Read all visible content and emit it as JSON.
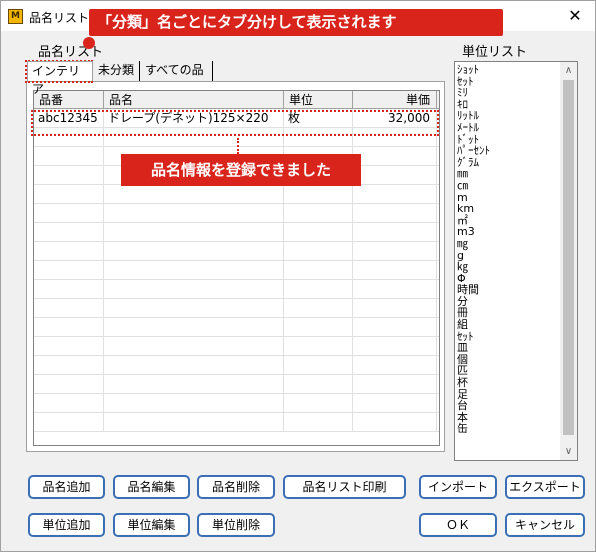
{
  "window": {
    "title": "品名リスト編集",
    "close_glyph": "✕"
  },
  "labels": {
    "hinmei_list": "品名リスト",
    "unit_list": "単位リスト"
  },
  "tabs": [
    {
      "label": "インテリア",
      "active": true
    },
    {
      "label": "未分類",
      "active": false
    },
    {
      "label": "すべての品",
      "active": false
    }
  ],
  "grid": {
    "columns": [
      "品番",
      "品名",
      "単位",
      "単価"
    ],
    "rows": [
      {
        "code": "abc12345",
        "name": "ドレープ(デネット)125×220",
        "unit": "枚",
        "price": "32,000"
      }
    ]
  },
  "units": [
    "ｼｮｯﾄ",
    "ｾｯﾄ",
    "ﾐﾘ",
    "ｷﾛ",
    "ﾘｯﾄﾙ",
    "ﾒｰﾄﾙ",
    "ﾄﾞｯﾄ",
    "ﾊﾟｰｾﾝﾄ",
    "ｸﾞﾗﾑ",
    "㎜",
    "㎝",
    "m",
    "km",
    "㎡",
    "m3",
    "㎎",
    "g",
    "㎏",
    "Φ",
    "時間",
    "分",
    "冊",
    "組",
    "ｾｯﾄ",
    "皿",
    "個",
    "匹",
    "杯",
    "足",
    "台",
    "本",
    "缶"
  ],
  "buttons": {
    "add_item": "品名追加",
    "edit_item": "品名編集",
    "delete_item": "品名削除",
    "print_list": "品名リスト印刷",
    "import": "インポート",
    "export": "エクスポート",
    "add_unit": "単位追加",
    "edit_unit": "単位編集",
    "delete_unit": "単位削除",
    "ok": "ＯＫ",
    "cancel": "キャンセル"
  },
  "annotations": {
    "tabs_note": "「分類」名ごとにタブ分けして表示されます",
    "registered_note": "品名情報を登録できました"
  },
  "colors": {
    "accent": "#d9241c",
    "button_border": "#3a6fb5"
  }
}
